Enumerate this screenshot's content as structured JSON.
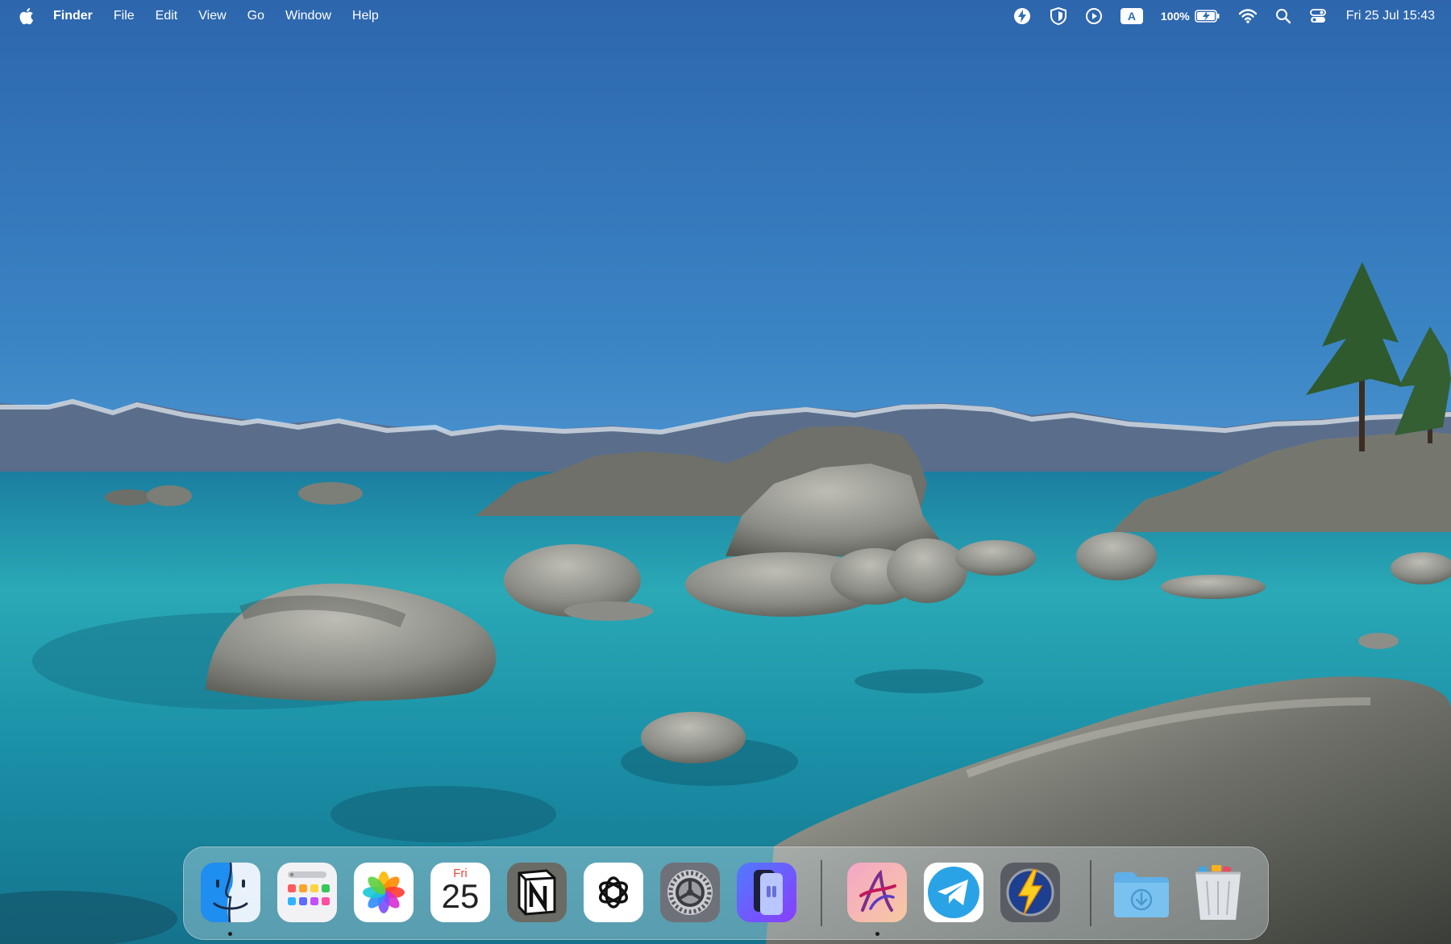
{
  "menubar": {
    "app_name": "Finder",
    "items": [
      {
        "label": "File"
      },
      {
        "label": "Edit"
      },
      {
        "label": "View"
      },
      {
        "label": "Go"
      },
      {
        "label": "Window"
      },
      {
        "label": "Help"
      }
    ],
    "status": {
      "keyboard_input": "A",
      "battery_percent": "100%",
      "datetime": "Fri 25 Jul  15:43"
    }
  },
  "dock": {
    "apps": [
      {
        "name": "Finder",
        "icon": "finder-icon",
        "running": true
      },
      {
        "name": "Launchpad",
        "icon": "launchpad-icon",
        "running": false
      },
      {
        "name": "Photos",
        "icon": "photos-icon",
        "running": false
      },
      {
        "name": "Calendar",
        "icon": "calendar-icon",
        "running": false,
        "day": "Fri",
        "date": "25"
      },
      {
        "name": "Notion",
        "icon": "notion-icon",
        "running": false
      },
      {
        "name": "ChatGPT",
        "icon": "chatgpt-icon",
        "running": false
      },
      {
        "name": "System Settings",
        "icon": "gear-icon",
        "running": false
      },
      {
        "name": "iPhone Mirroring",
        "icon": "iphone-mirroring-icon",
        "running": false
      },
      {
        "name": "Affinity Designer",
        "icon": "affinity-icon",
        "running": true
      },
      {
        "name": "Telegram",
        "icon": "telegram-icon",
        "running": false
      },
      {
        "name": "Reeder",
        "icon": "lightning-icon",
        "running": false
      },
      {
        "name": "Downloads",
        "icon": "downloads-folder-icon",
        "running": false
      },
      {
        "name": "Trash",
        "icon": "trash-icon",
        "running": false
      }
    ]
  },
  "colors": {
    "sky": "#2e6eb5",
    "water": "#1fa3b0",
    "menubar_text": "#ffffff"
  }
}
